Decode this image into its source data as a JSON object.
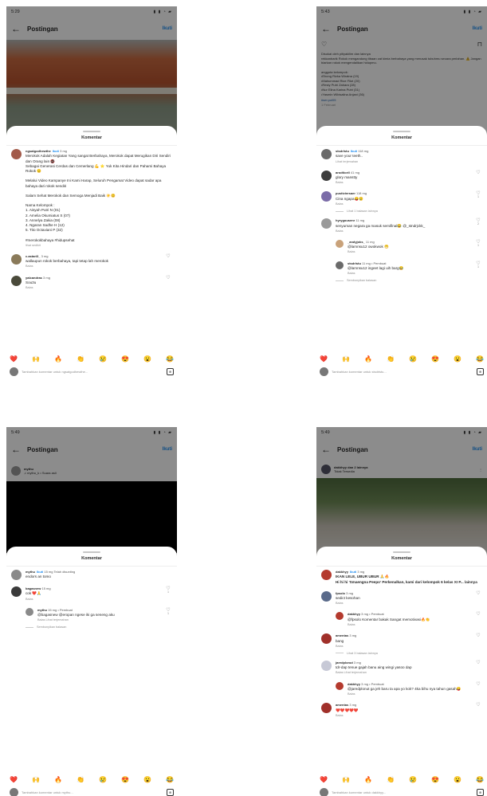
{
  "status_time": "5:29",
  "status_icons": "▮ ▮ ◔ ▰",
  "phones": [
    {
      "time": "5:29",
      "header": {
        "title": "Postingan",
        "follow": "Ikuti"
      },
      "sheet_title": "Komentar",
      "comments": [
        {
          "user": "ngsatgodhewthe",
          "follow": "Ikuti",
          "age": "3 mg",
          "text": "Merokok Adalah Kegiatan Yang sangat Berbahaya, Merokok dapat Merugikan Diri Sendiri dan Orang lain 🚭\nSebagai Generasi Cerdas dan Cemerlang 💪 ⭐ Yuk Kita Hindari dan Pahami Bahaya Rokok 😌\n\nMelalui Video Kampanye Ini Kami Harap, Seluruh Pengamat Video dapat sadar apa bahaya dari rokok sendiri\n\nSalam Sehat Merokok dan Semoga Menjadi Baik ☀️😊\n\nNama Kelompok :\n1. Aisyah Putri N (01)\n2. Amelia Okumiatus S (07)\n3. Annelya Zakia (08)\n4. Ngaran Sadhe H (12)\n5. Tito Octaviani P (32)\n\n#merokokbahaya #hidupsehat",
          "sub": "lihat sedikit",
          "liked": false
        },
        {
          "user": "c.astari3_",
          "age": "3 mg",
          "text": "wallaupun rokok berbahaya, tapi tetap lah merokok",
          "sub": "Balas",
          "liked": false
        },
        {
          "user": "yalcandras",
          "age": "3 mg",
          "text": "Sou3u",
          "sub": "Balas",
          "liked": false
        }
      ],
      "input_placeholder": "Tambahkan komentar untuk ngsatgodhewthe..."
    },
    {
      "time": "5:43",
      "header": {
        "title": "Postingan",
        "follow": "Ikuti"
      },
      "caption": "Disukai oleh pitiyakilim dan lainnya\nrekkanbarik Rokok mengandung tibaan zat kimia berbahaya yang merusak tubuhmu secara perlahan. ⚠️ Jangan biarkan rokok mengendalikan hidupmu.\n\nanggota kelompok:\n•Ebong Rizka Wiratna (19)\n•Mahummad Rice Fikri (20)\n•Resty Putri Zahara (28)\n•Nur Elina Karina Putri (31)\n•Yasmin Wibisalina Anjani (36)",
      "caption_link": "#ser.pol05",
      "caption_date": "1 Februari",
      "sheet_title": "Komentar",
      "comments": [
        {
          "user": "stsdrlstu",
          "follow": "Ikuti",
          "age": "118 mg",
          "text": "save your teeth..",
          "sub": "Lihat terjemahan",
          "liked": false,
          "reply": false
        },
        {
          "user": "arodticell",
          "age": "41 mg",
          "text": "glory manstty",
          "sub": "Balas",
          "liked": false,
          "reply": false
        },
        {
          "user": "pustiviersaer",
          "age": "118 mg",
          "text": "Cina ngapa😝😢",
          "sub": "Balas",
          "liked": false,
          "reply": false,
          "count": "1"
        },
        {
          "user": "hyrygousenr",
          "age": "11 mg",
          "text": "senyuman negara ga masuk semifinal😂 @_stndrjckk_",
          "sub": "Balas",
          "liked": false,
          "reply": false,
          "count": "2"
        },
        {
          "user": "_andyjoks_",
          "age": "11 mg",
          "text": "@lamnsu12 owokwok 😁",
          "sub": "Balas",
          "liked": false,
          "reply": true,
          "count": "1"
        },
        {
          "user": "stsdrlstu",
          "age": "11 mg • Pembuat",
          "text": "@lamnsu12 ingeet lagi uih barg😂",
          "sub": "Balas",
          "liked": false,
          "reply": true,
          "count": "1"
        }
      ],
      "view_more": [
        "Lihat 1 balasan lainnya",
        "Sembunyikan balasan"
      ],
      "input_placeholder": "Tambahkan komentar untuk stsdrlstu..."
    },
    {
      "time": "5:49",
      "header": {
        "title": "Postingan",
        "follow": "Ikuti"
      },
      "poster": {
        "user": "mythu",
        "audio": "♫ mythu_k • Suara asli"
      },
      "sheet_title": "Komentar",
      "comments": [
        {
          "user": "mythu",
          "follow": "Ikuti",
          "age": "15 mg",
          "extra": "Telah disunting",
          "text": "endors an tomo",
          "sub": "",
          "liked": false,
          "reply": false
        },
        {
          "user": "bagasnew",
          "age": "15 mg",
          "text": "cok ❤️🙏",
          "sub": "Balas",
          "liked": false,
          "reply": false,
          "count": "1"
        },
        {
          "user": "mythu",
          "age": "15 mg • Pembuat",
          "text": "@bagasnew @eropan ngese iki ga seneng aku",
          "sub": "Balas   Lihat terjemahan",
          "liked": false,
          "reply": true,
          "count": "1"
        }
      ],
      "view_more": [
        "Sembunyikan balasan"
      ],
      "input_placeholder": "Tambahkan komentar untuk mythu..."
    },
    {
      "time": "5:49",
      "header": {
        "title": "Postingan",
        "follow": "Ikuti"
      },
      "poster": {
        "user": "dakkhyy dan 2 lainnya",
        "audio": "Tidak Tersedia"
      },
      "sheet_title": "Komentar",
      "comments": [
        {
          "user": "dakkhyy",
          "follow": "Ikuti",
          "age": "3 mg",
          "text": "IKAN LELE, UBUR UBUR 🙏🔥\nHi hi hi 'Smaengna Peepo' Perkenalkan, kami dari kelompok 6 kelas XI P... lainnya",
          "sub": "",
          "liked": false,
          "reply": false
        },
        {
          "user": "fpsolo",
          "age": "3 mg",
          "text": "sedict kesohan",
          "sub": "Balas",
          "liked": false,
          "reply": false
        },
        {
          "user": "dakkhyy",
          "age": "3 mg • Pembuat",
          "text": "@fpsolo Komentar bakak Sangat memotivasi🔥👏",
          "sub": "Balas",
          "liked": false,
          "reply": true
        },
        {
          "user": "amentas",
          "age": "3 mg",
          "text": "bang",
          "sub": "Balas",
          "liked": false,
          "reply": false
        },
        {
          "user": "jaredplonut",
          "age": "3 mg",
          "text": "tdr-dap tenue gajah banu aing wingi yasoo dap",
          "sub": "Balas   Lihat terjemahan",
          "liked": false,
          "reply": false
        },
        {
          "user": "dakkhyy",
          "age": "3 mg • Pembuat",
          "text": "@jaredplonut ga jeh baru ta apa yo kok? 4ka bihu nya tahun gasah😝",
          "sub": "Balas",
          "liked": false,
          "reply": true
        },
        {
          "user": "amentas",
          "age": "3 mg",
          "text": "❤️❤️❤️❤️❤️",
          "sub": "Balas",
          "liked": false,
          "reply": false
        }
      ],
      "view_more": [
        "Lihat 3 balasan lainnya"
      ],
      "input_placeholder": "Tambahkan komentar untuk dakkhyy..."
    }
  ],
  "emojis": [
    "❤️",
    "🙌",
    "🔥",
    "👏",
    "😢",
    "😍",
    "😮",
    "😂"
  ],
  "icons": {
    "back": "←",
    "heart": "♡",
    "gif": "⊕",
    "more": "⋮"
  }
}
